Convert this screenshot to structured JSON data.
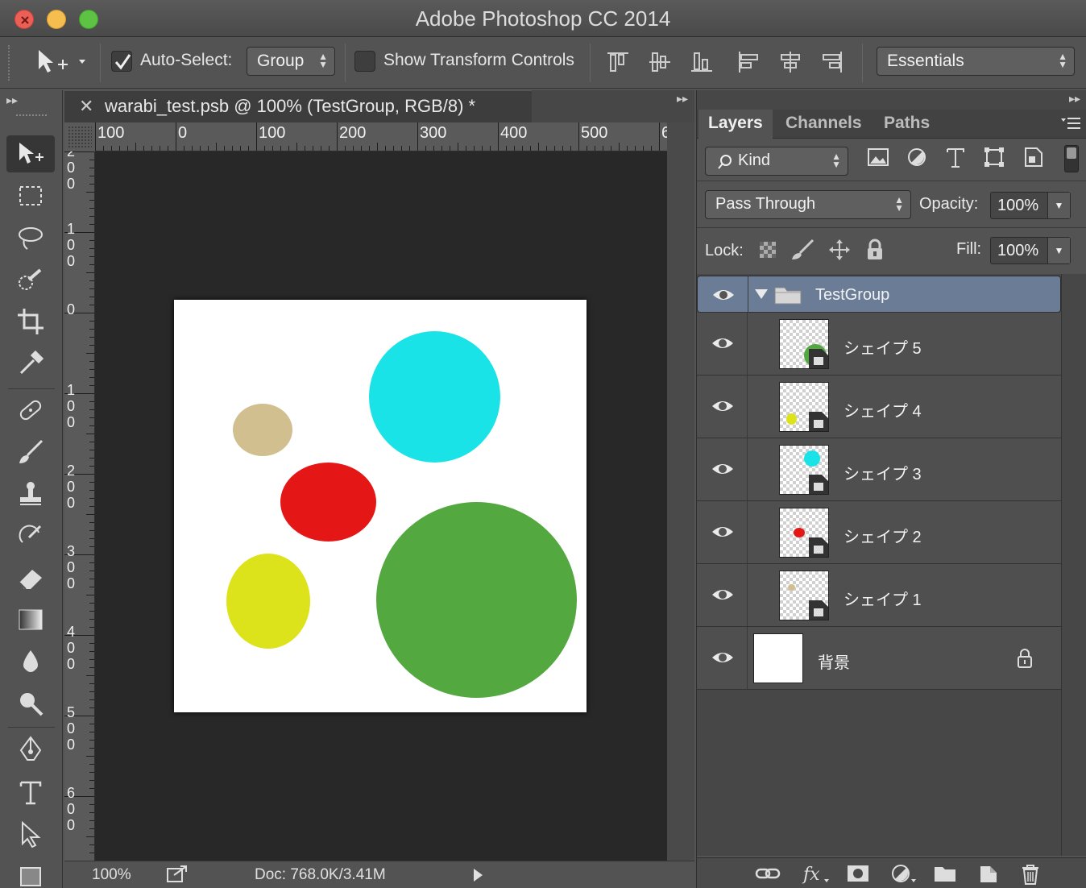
{
  "window": {
    "title": "Adobe Photoshop CC 2014"
  },
  "colors": {
    "close": "#ec5f57",
    "minimize": "#f5be4f",
    "zoom": "#5ec244",
    "selected_layer": "#6a7c96"
  },
  "options_bar": {
    "auto_select_label": "Auto-Select:",
    "auto_select_checked": true,
    "auto_select_mode": "Group",
    "show_transform_label": "Show Transform Controls",
    "show_transform_checked": false,
    "workspace": "Essentials"
  },
  "document": {
    "tab_title": "warabi_test.psb @ 100% (TestGroup, RGB/8) *",
    "zoom": "100%",
    "doc_info": "Doc: 768.0K/3.41M",
    "h_ruler_labels": [
      "100",
      "0",
      "100",
      "200",
      "300",
      "400",
      "500",
      "6"
    ],
    "v_ruler_labels": [
      "2\n0\n0",
      "1\n0\n0",
      "0",
      "1\n0\n0",
      "2\n0\n0",
      "3\n0\n0",
      "4\n0\n0",
      "5\n0\n0",
      "6\n0\n0"
    ],
    "shapes": [
      {
        "name": "cyan-circle",
        "color": "#19e3e6"
      },
      {
        "name": "tan-ellipse",
        "color": "#d2bf8f"
      },
      {
        "name": "red-ellipse",
        "color": "#e51616"
      },
      {
        "name": "yellow-ellipse",
        "color": "#dde31a"
      },
      {
        "name": "green-circle",
        "color": "#53a840"
      }
    ]
  },
  "layers_panel": {
    "tabs": [
      "Layers",
      "Channels",
      "Paths"
    ],
    "active_tab": "Layers",
    "filter_kind": "Kind",
    "blend_mode": "Pass Through",
    "opacity_label": "Opacity:",
    "opacity": "100%",
    "lock_label": "Lock:",
    "fill_label": "Fill:",
    "fill": "100%",
    "group": {
      "name": "TestGroup",
      "expanded": true
    },
    "layers": [
      {
        "name": "シェイプ 5",
        "dot_color": "#53a840"
      },
      {
        "name": "シェイプ 4",
        "dot_color": "#dde31a"
      },
      {
        "name": "シェイプ 3",
        "dot_color": "#19e3e6"
      },
      {
        "name": "シェイプ 2",
        "dot_color": "#e51616"
      },
      {
        "name": "シェイプ 1",
        "dot_color": "#d2bf8f"
      }
    ],
    "background_layer": {
      "name": "背景",
      "locked": true
    }
  }
}
